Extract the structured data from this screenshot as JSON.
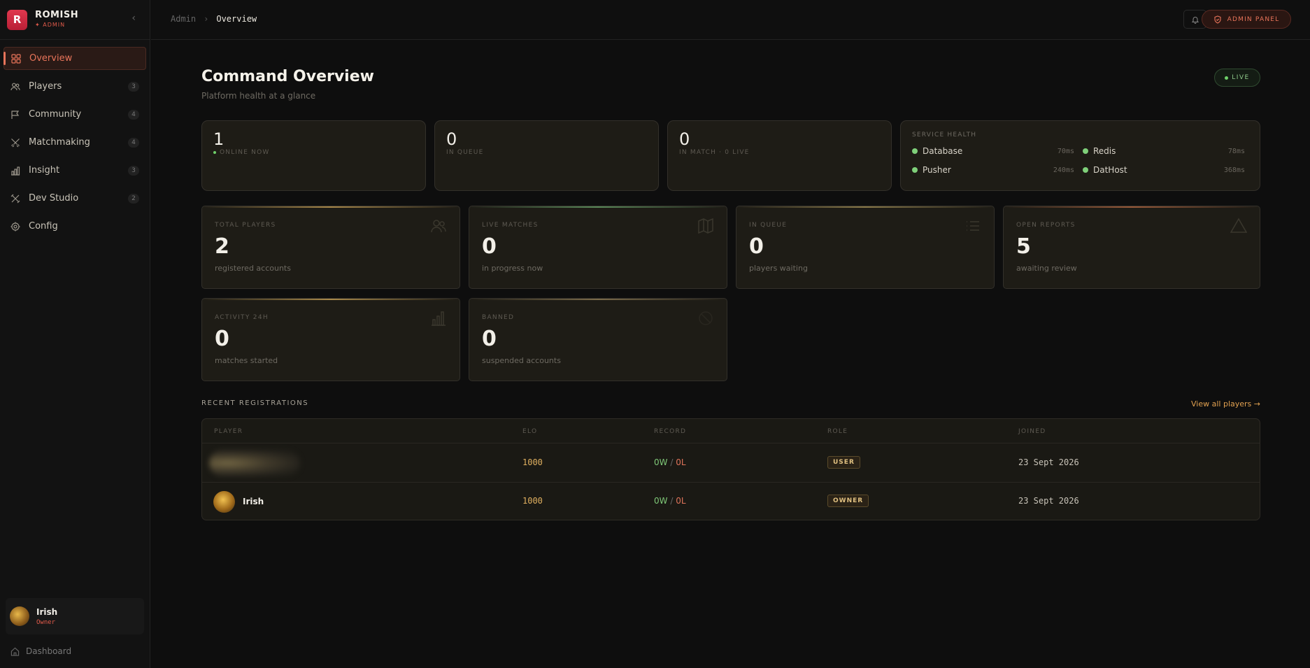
{
  "brand": {
    "logo_letter": "R",
    "name": "ROMISH",
    "sub": "✦ ADMIN",
    "collapse_glyph": "‹"
  },
  "nav": [
    {
      "label": "Overview",
      "count": "",
      "icon": "grid-icon",
      "active": true
    },
    {
      "label": "Players",
      "count": "3",
      "icon": "users-icon"
    },
    {
      "label": "Community",
      "count": "4",
      "icon": "flag-icon"
    },
    {
      "label": "Matchmaking",
      "count": "4",
      "icon": "swords-icon"
    },
    {
      "label": "Insight",
      "count": "3",
      "icon": "bar-chart-icon"
    },
    {
      "label": "Dev Studio",
      "count": "2",
      "icon": "tools-icon"
    },
    {
      "label": "Config",
      "count": "",
      "icon": "gear-icon"
    }
  ],
  "user": {
    "name": "Irish",
    "role": "Owner"
  },
  "footer": {
    "dashboard_label": "Dashboard"
  },
  "topbar": {
    "crumb_root": "Admin",
    "crumb_sep": "›",
    "crumb_current": "Overview",
    "admin_button": "ADMIN PANEL"
  },
  "header": {
    "title": "Command Overview",
    "subtitle": "Platform health at a glance",
    "live_label": "LIVE"
  },
  "status": {
    "online": {
      "value": "1",
      "label": "ONLINE NOW"
    },
    "queue": {
      "value": "0",
      "label": "IN QUEUE"
    },
    "match": {
      "value": "0",
      "label": "IN MATCH · 0 LIVE"
    }
  },
  "health": {
    "title": "SERVICE HEALTH",
    "services": [
      {
        "name": "Database",
        "ms": "70ms"
      },
      {
        "name": "Redis",
        "ms": "78ms"
      },
      {
        "name": "Pusher",
        "ms": "240ms"
      },
      {
        "name": "DatHost",
        "ms": "368ms"
      }
    ]
  },
  "metrics": [
    {
      "label": "TOTAL PLAYERS",
      "value": "2",
      "desc": "registered accounts",
      "accent": "#a8884a",
      "icon": "users-icon"
    },
    {
      "label": "LIVE MATCHES",
      "value": "0",
      "desc": "in progress now",
      "accent": "#5a8a5a",
      "icon": "map-icon"
    },
    {
      "label": "IN QUEUE",
      "value": "0",
      "desc": "players waiting",
      "accent": "#8a7a4a",
      "icon": "list-icon"
    },
    {
      "label": "OPEN REPORTS",
      "value": "5",
      "desc": "awaiting review",
      "accent": "#9a5a3a",
      "icon": "warning-icon"
    },
    {
      "label": "ACTIVITY 24H",
      "value": "0",
      "desc": "matches started",
      "accent": "#a8884a",
      "icon": "bar-chart-icon"
    },
    {
      "label": "BANNED",
      "value": "0",
      "desc": "suspended accounts",
      "accent": "#7a6a4a",
      "icon": "ban-icon"
    }
  ],
  "registrations": {
    "title": "RECENT REGISTRATIONS",
    "view_all": "View all players →",
    "columns": [
      "PLAYER",
      "ELO",
      "RECORD",
      "ROLE",
      "JOINED"
    ],
    "rows": [
      {
        "name": "",
        "elo": "1000",
        "wins": "0W",
        "sep": "/",
        "losses": "0L",
        "role": "USER",
        "joined": "23 Sept 2026"
      },
      {
        "name": "Irish",
        "elo": "1000",
        "wins": "0W",
        "sep": "/",
        "losses": "0L",
        "role": "OWNER",
        "joined": "23 Sept 2026"
      }
    ]
  }
}
